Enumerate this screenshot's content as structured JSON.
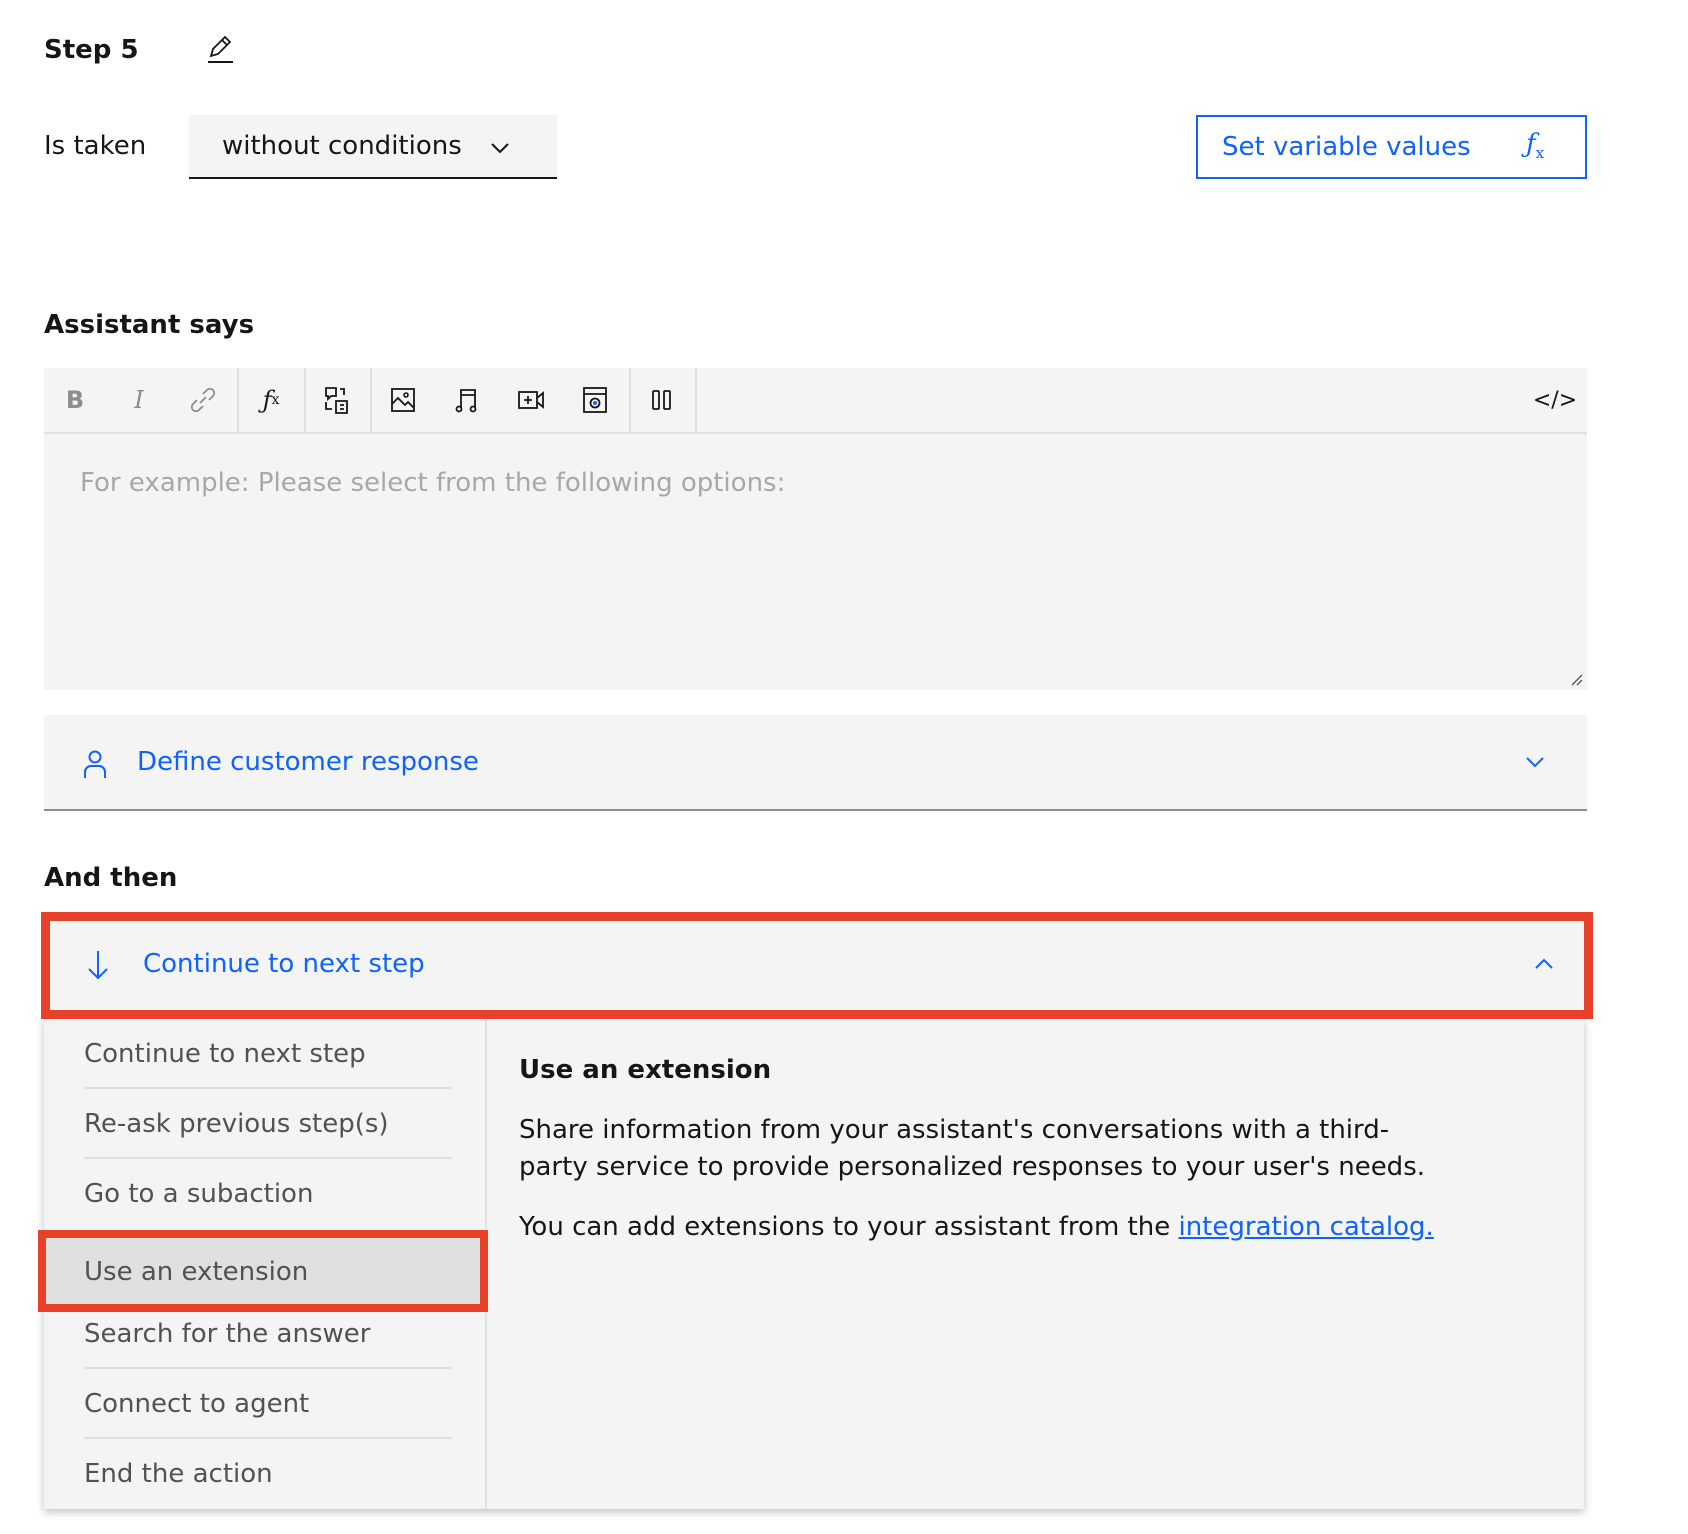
{
  "step": {
    "title": "Step 5",
    "edit_icon": "pencil-icon"
  },
  "condition": {
    "label": "Is taken",
    "selected": "without conditions"
  },
  "set_variables": {
    "label": "Set variable values",
    "icon": "function-icon"
  },
  "assistant_says": {
    "title": "Assistant says",
    "toolbar": [
      "bold-icon",
      "italic-icon",
      "link-icon",
      "function-icon",
      "option-icon",
      "image-icon",
      "audio-icon",
      "video-icon",
      "iframe-icon",
      "columns-icon",
      "code-icon"
    ],
    "bold_label": "B",
    "italic_label": "I",
    "code_label": "</>",
    "placeholder": "For example: Please select from the following options:"
  },
  "customer_response": {
    "label": "Define customer response",
    "icon": "user-icon"
  },
  "and_then": {
    "title": "And then",
    "selected": "Continue to next step",
    "options": [
      "Continue to next step",
      "Re-ask previous step(s)",
      "Go to a subaction",
      "Use an extension",
      "Search for the answer",
      "Connect to agent",
      "End the action"
    ],
    "highlighted": "Use an extension",
    "detail": {
      "title": "Use an extension",
      "line1": "Share information from your assistant's conversations with a third-",
      "line2": "party service to provide personalized responses to your user's needs.",
      "line3_prefix": "You can add extensions to your assistant from the ",
      "link": "integration catalog."
    }
  },
  "colors": {
    "accent": "#0f62fe",
    "highlight_box": "#e8412a",
    "panel": "#f4f4f4"
  }
}
